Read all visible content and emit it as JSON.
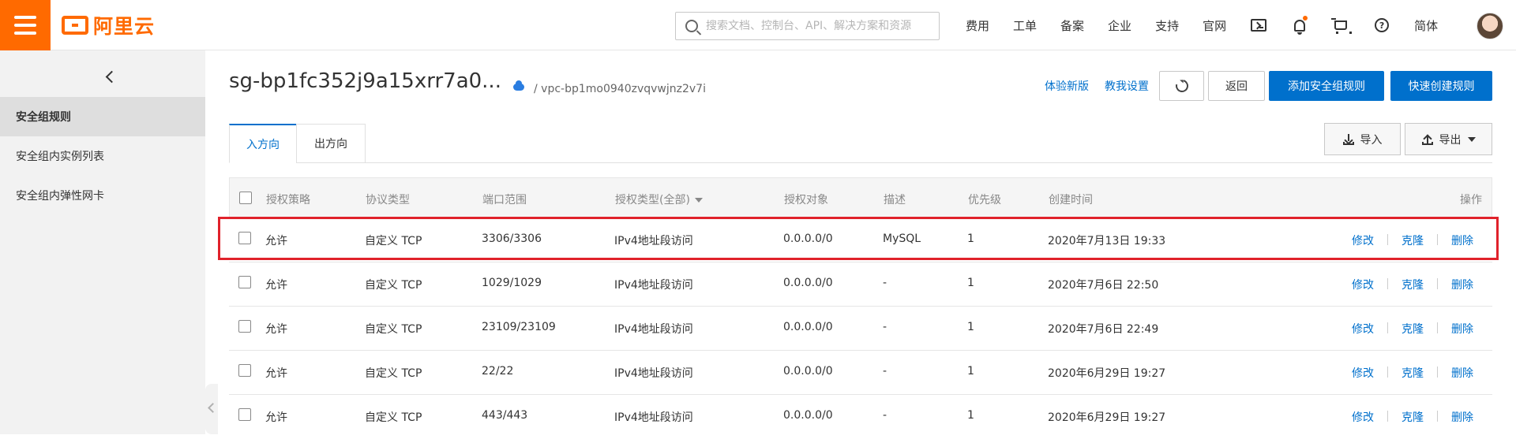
{
  "header": {
    "logo_text": "阿里云",
    "search_placeholder": "搜索文档、控制台、API、解决方案和资源",
    "nav": [
      "费用",
      "工单",
      "备案",
      "企业",
      "支持",
      "官网"
    ],
    "lang": "简体",
    "icons": [
      "terminal-icon",
      "bell-icon",
      "cart-icon",
      "help-icon"
    ],
    "accent_color": "#ff6a00"
  },
  "sidebar": {
    "items": [
      {
        "label": "安全组规则",
        "active": true
      },
      {
        "label": "安全组内实例列表",
        "active": false
      },
      {
        "label": "安全组内弹性网卡",
        "active": false
      }
    ]
  },
  "page": {
    "title": "sg-bp1fc352j9a15xrr7a0...",
    "vpc": "/ vpc-bp1mo0940zvqvwjnz2v7i",
    "links": {
      "new_version": "体验新版",
      "teach_me": "教我设置"
    },
    "buttons": {
      "back": "返回",
      "add_rule": "添加安全组规则",
      "quick_create": "快速创建规则"
    },
    "tabs": [
      "入方向",
      "出方向"
    ],
    "import": "导入",
    "export": "导出",
    "primary_color": "#0070cc"
  },
  "table": {
    "columns": [
      "授权策略",
      "协议类型",
      "端口范围",
      "授权类型(全部)",
      "授权对象",
      "描述",
      "优先级",
      "创建时间",
      "操作"
    ],
    "rows": [
      {
        "policy": "允许",
        "protocol": "自定义 TCP",
        "port": "3306/3306",
        "auth_type": "IPv4地址段访问",
        "object": "0.0.0.0/0",
        "desc": "MySQL",
        "priority": "1",
        "created": "2020年7月13日 19:33"
      },
      {
        "policy": "允许",
        "protocol": "自定义 TCP",
        "port": "1029/1029",
        "auth_type": "IPv4地址段访问",
        "object": "0.0.0.0/0",
        "desc": "-",
        "priority": "1",
        "created": "2020年7月6日 22:50"
      },
      {
        "policy": "允许",
        "protocol": "自定义 TCP",
        "port": "23109/23109",
        "auth_type": "IPv4地址段访问",
        "object": "0.0.0.0/0",
        "desc": "-",
        "priority": "1",
        "created": "2020年7月6日 22:49"
      },
      {
        "policy": "允许",
        "protocol": "自定义 TCP",
        "port": "22/22",
        "auth_type": "IPv4地址段访问",
        "object": "0.0.0.0/0",
        "desc": "-",
        "priority": "1",
        "created": "2020年6月29日 19:27"
      },
      {
        "policy": "允许",
        "protocol": "自定义 TCP",
        "port": "443/443",
        "auth_type": "IPv4地址段访问",
        "object": "0.0.0.0/0",
        "desc": "-",
        "priority": "1",
        "created": "2020年6月29日 19:27"
      }
    ],
    "actions": [
      "修改",
      "克隆",
      "删除"
    ],
    "highlight_color": "#e0222b"
  }
}
